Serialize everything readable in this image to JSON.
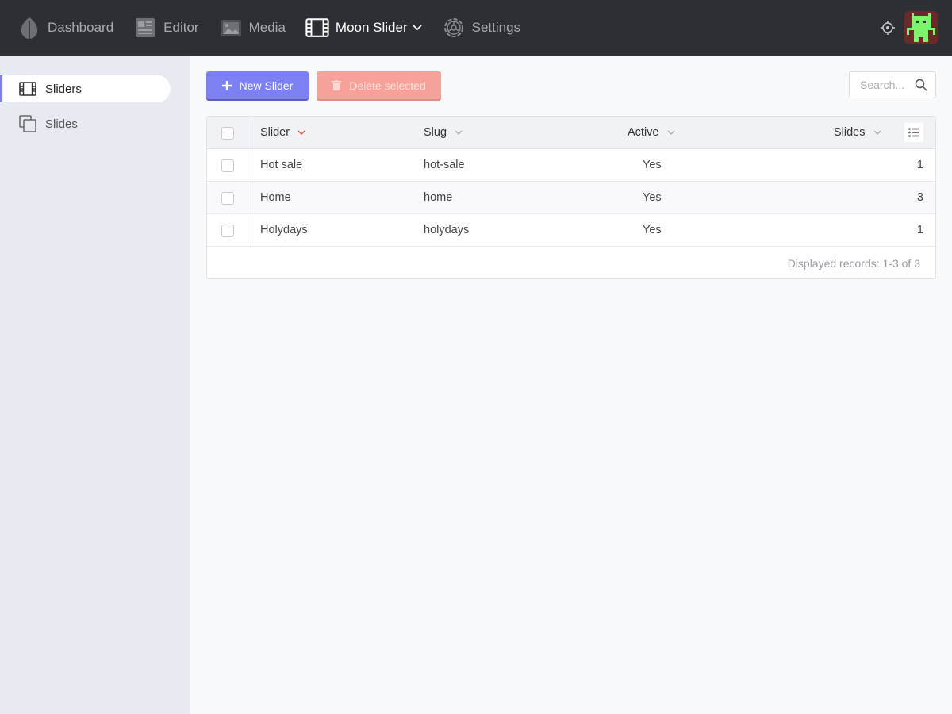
{
  "nav": {
    "items": [
      {
        "label": "Dashboard",
        "icon": "leaf-icon"
      },
      {
        "label": "Editor",
        "icon": "newspaper-icon"
      },
      {
        "label": "Media",
        "icon": "image-icon"
      },
      {
        "label": "Moon Slider",
        "icon": "film-icon",
        "active": true
      },
      {
        "label": "Settings",
        "icon": "gear-icon"
      }
    ]
  },
  "sidebar": {
    "items": [
      {
        "label": "Sliders",
        "icon": "film-icon",
        "active": true
      },
      {
        "label": "Slides",
        "icon": "copy-icon"
      }
    ]
  },
  "toolbar": {
    "new_label": "New Slider",
    "delete_label": "Delete selected"
  },
  "search": {
    "placeholder": "Search..."
  },
  "table": {
    "columns": [
      "Slider",
      "Slug",
      "Active",
      "Slides"
    ],
    "rows": [
      {
        "slider": "Hot sale",
        "slug": "hot-sale",
        "active": "Yes",
        "slides": "1"
      },
      {
        "slider": "Home",
        "slug": "home",
        "active": "Yes",
        "slides": "3"
      },
      {
        "slider": "Holydays",
        "slug": "holydays",
        "active": "Yes",
        "slides": "1"
      }
    ],
    "footer": "Displayed records: 1-3 of 3"
  },
  "colors": {
    "topbar": "#2c3034",
    "accent": "#7d80f3",
    "danger": "#f6a29a",
    "sidebar": "#e8eaf2",
    "sort_active": "#e0524a"
  }
}
